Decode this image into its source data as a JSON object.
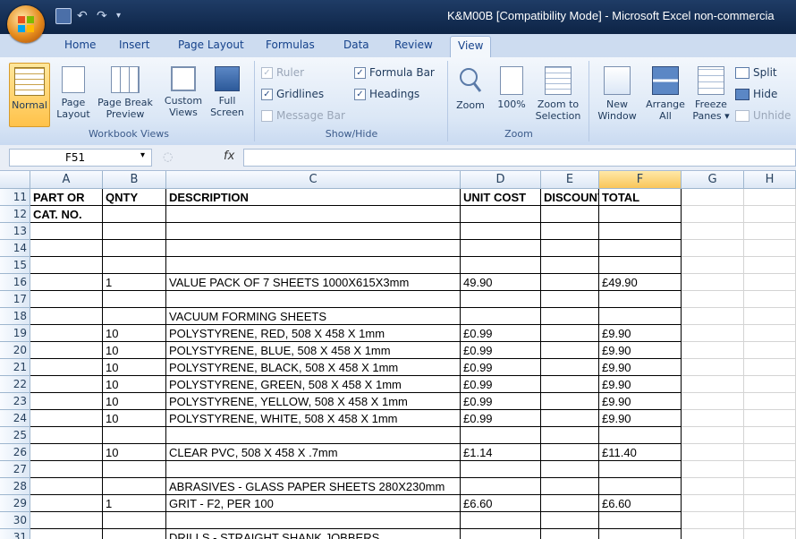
{
  "window": {
    "title": "K&M00B  [Compatibility Mode] - Microsoft Excel non-commercia"
  },
  "tabs": [
    "Home",
    "Insert",
    "Page Layout",
    "Formulas",
    "Data",
    "Review",
    "View"
  ],
  "active_tab": "View",
  "ribbon": {
    "workbook_views": {
      "label": "Workbook Views",
      "normal": "Normal",
      "page_layout_1": "Page",
      "page_layout_2": "Layout",
      "page_break_1": "Page Break",
      "page_break_2": "Preview",
      "custom_views_1": "Custom",
      "custom_views_2": "Views",
      "full_screen_1": "Full",
      "full_screen_2": "Screen"
    },
    "show_hide": {
      "label": "Show/Hide",
      "ruler": "Ruler",
      "formula_bar": "Formula Bar",
      "gridlines": "Gridlines",
      "headings": "Headings",
      "message_bar": "Message Bar"
    },
    "zoom": {
      "label": "Zoom",
      "zoom": "Zoom",
      "hundred": "100%",
      "zoom_sel_1": "Zoom to",
      "zoom_sel_2": "Selection"
    },
    "window_group": {
      "new_1": "New",
      "new_2": "Window",
      "arrange_1": "Arrange",
      "arrange_2": "All",
      "freeze_1": "Freeze",
      "freeze_2": "Panes ▾",
      "split": "Split",
      "hide": "Hide",
      "unhide": "Unhide"
    }
  },
  "formula_bar": {
    "name_box": "F51",
    "fx": "fx"
  },
  "columns": [
    "A",
    "B",
    "C",
    "D",
    "E",
    "F",
    "G",
    "H"
  ],
  "rows": [
    {
      "n": "11",
      "a": "PART OR",
      "b": "QNTY",
      "c": "DESCRIPTION",
      "d": "UNIT COST",
      "e": "DISCOUNT",
      "f": "TOTAL"
    },
    {
      "n": "12",
      "a": "CAT. NO.",
      "b": "",
      "c": "",
      "d": "",
      "e": "",
      "f": ""
    },
    {
      "n": "13",
      "a": "",
      "b": "",
      "c": "",
      "d": "",
      "e": "",
      "f": ""
    },
    {
      "n": "14",
      "a": "",
      "b": "",
      "c": "",
      "d": "",
      "e": "",
      "f": ""
    },
    {
      "n": "15",
      "a": "",
      "b": "",
      "c": "",
      "d": "",
      "e": "",
      "f": ""
    },
    {
      "n": "16",
      "a": "",
      "b": "1",
      "c": "VALUE PACK OF 7 SHEETS 1000X615X3mm",
      "d": "49.90",
      "e": "",
      "f": "£49.90"
    },
    {
      "n": "17",
      "a": "",
      "b": "",
      "c": "",
      "d": "",
      "e": "",
      "f": ""
    },
    {
      "n": "18",
      "a": "",
      "b": "",
      "c": "VACUUM FORMING SHEETS",
      "d": "",
      "e": "",
      "f": ""
    },
    {
      "n": "19",
      "a": "",
      "b": "10",
      "c": "POLYSTYRENE, RED, 508 X 458 X 1mm",
      "d": "£0.99",
      "e": "",
      "f": "£9.90"
    },
    {
      "n": "20",
      "a": "",
      "b": "10",
      "c": "POLYSTYRENE, BLUE, 508 X 458 X 1mm",
      "d": "£0.99",
      "e": "",
      "f": "£9.90"
    },
    {
      "n": "21",
      "a": "",
      "b": "10",
      "c": "POLYSTYRENE, BLACK, 508 X 458 X 1mm",
      "d": "£0.99",
      "e": "",
      "f": "£9.90"
    },
    {
      "n": "22",
      "a": "",
      "b": "10",
      "c": "POLYSTYRENE, GREEN, 508 X 458 X 1mm",
      "d": "£0.99",
      "e": "",
      "f": "£9.90"
    },
    {
      "n": "23",
      "a": "",
      "b": "10",
      "c": "POLYSTYRENE, YELLOW, 508 X 458 X 1mm",
      "d": "£0.99",
      "e": "",
      "f": "£9.90"
    },
    {
      "n": "24",
      "a": "",
      "b": "10",
      "c": "POLYSTYRENE, WHITE, 508 X 458 X 1mm",
      "d": "£0.99",
      "e": "",
      "f": "£9.90"
    },
    {
      "n": "25",
      "a": "",
      "b": "",
      "c": "",
      "d": "",
      "e": "",
      "f": ""
    },
    {
      "n": "26",
      "a": "",
      "b": "10",
      "c": "CLEAR PVC, 508 X 458 X .7mm",
      "d": "£1.14",
      "e": "",
      "f": "£11.40"
    },
    {
      "n": "27",
      "a": "",
      "b": "",
      "c": "",
      "d": "",
      "e": "",
      "f": ""
    },
    {
      "n": "28",
      "a": "",
      "b": "",
      "c": "ABRASIVES - GLASS PAPER SHEETS 280X230mm",
      "d": "",
      "e": "",
      "f": ""
    },
    {
      "n": "29",
      "a": "",
      "b": "1",
      "c": "GRIT - F2, PER 100",
      "d": "£6.60",
      "e": "",
      "f": "£6.60"
    },
    {
      "n": "30",
      "a": "",
      "b": "",
      "c": "",
      "d": "",
      "e": "",
      "f": ""
    },
    {
      "n": "31",
      "a": "",
      "b": "",
      "c": "DRILLS - STRAIGHT SHANK JOBBERS",
      "d": "",
      "e": "",
      "f": ""
    }
  ],
  "colors": {
    "selected_col_header": "#f9c55a",
    "ribbon_bg": "#dbe7f6",
    "titlebar": "#0d2446"
  }
}
